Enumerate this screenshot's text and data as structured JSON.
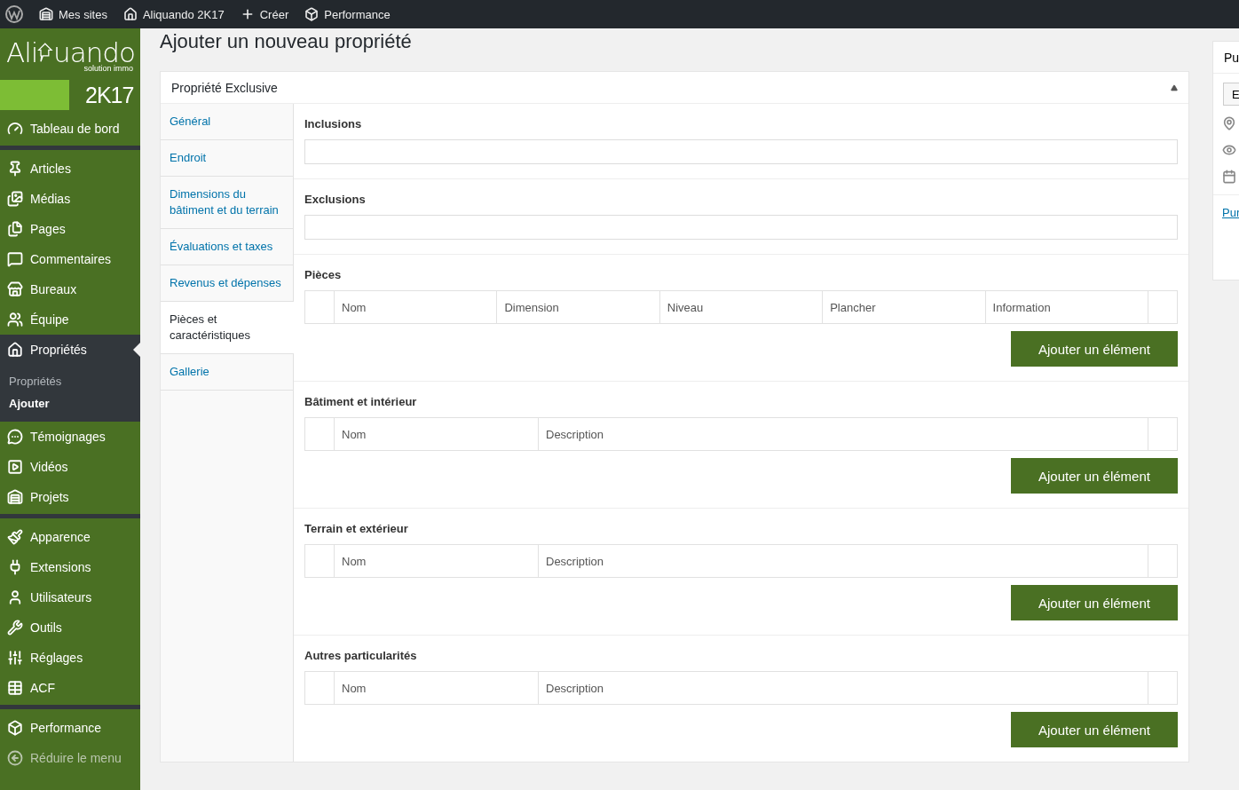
{
  "admin_bar": {
    "items": [
      {
        "kind": "logo"
      },
      {
        "label": "Mes sites"
      },
      {
        "label": "Aliquando 2K17"
      },
      {
        "label": "Créer"
      },
      {
        "label": "Performance"
      }
    ]
  },
  "logo": {
    "text_before": "Ali",
    "text_after": "uando",
    "tagline": "solution immo",
    "edition": "2K17"
  },
  "sidebar": {
    "groups": [
      [
        {
          "label": "Tableau de bord",
          "selected": false
        }
      ],
      [
        {
          "label": "Articles",
          "selected": false
        },
        {
          "label": "Médias",
          "selected": false
        },
        {
          "label": "Pages",
          "selected": false
        },
        {
          "label": "Commentaires",
          "selected": false
        },
        {
          "label": "Bureaux",
          "selected": false
        },
        {
          "label": "Équipe",
          "selected": false
        },
        {
          "label": "Propriétés",
          "selected": true,
          "children": [
            {
              "label": "Propriétés",
              "selected": false
            },
            {
              "label": "Ajouter",
              "selected": true
            }
          ]
        },
        {
          "label": "Témoignages",
          "selected": false
        },
        {
          "label": "Vidéos",
          "selected": false
        },
        {
          "label": "Projets",
          "selected": false
        }
      ],
      [
        {
          "label": "Apparence",
          "selected": false
        },
        {
          "label": "Extensions",
          "selected": false
        },
        {
          "label": "Utilisateurs",
          "selected": false
        },
        {
          "label": "Outils",
          "selected": false
        },
        {
          "label": "Réglages",
          "selected": false
        },
        {
          "label": "ACF",
          "selected": false
        }
      ],
      [
        {
          "label": "Performance",
          "selected": false
        },
        {
          "label": "Réduire le menu",
          "selected": false,
          "kind": "collapse"
        }
      ]
    ]
  },
  "page_title": "Ajouter un nouveau propriété",
  "metabox": {
    "title": "Propriété Exclusive",
    "expanded": true,
    "tabs": [
      {
        "label": "Général",
        "selected": false
      },
      {
        "label": "Endroit",
        "selected": false
      },
      {
        "label": "Dimensions du bâtiment et du terrain",
        "selected": false
      },
      {
        "label": "Évaluations et taxes",
        "selected": false
      },
      {
        "label": "Revenus et dépenses",
        "selected": false
      },
      {
        "label": "Pièces et caractéristiques",
        "selected": true
      },
      {
        "label": "Gallerie",
        "selected": false
      }
    ],
    "fields": [
      {
        "kind": "text",
        "label": "Inclusions"
      },
      {
        "kind": "text",
        "label": "Exclusions"
      },
      {
        "kind": "repeater",
        "label": "Pièces",
        "columns": [
          "Nom",
          "Dimension",
          "Niveau",
          "Plancher",
          "Information"
        ],
        "button": "Ajouter un élément"
      },
      {
        "kind": "repeater",
        "label": "Bâtiment et intérieur",
        "columns": [
          "Nom",
          "Description"
        ],
        "button": "Ajouter un élément"
      },
      {
        "kind": "repeater",
        "label": "Terrain et extérieur",
        "columns": [
          "Nom",
          "Description"
        ],
        "button": "Ajouter un élément"
      },
      {
        "kind": "repeater",
        "label": "Autres particularités",
        "columns": [
          "Nom",
          "Description"
        ],
        "button": "Ajouter un élément"
      }
    ]
  },
  "publish_box": {
    "title": "Pu",
    "button": "E",
    "link": "Pur"
  }
}
